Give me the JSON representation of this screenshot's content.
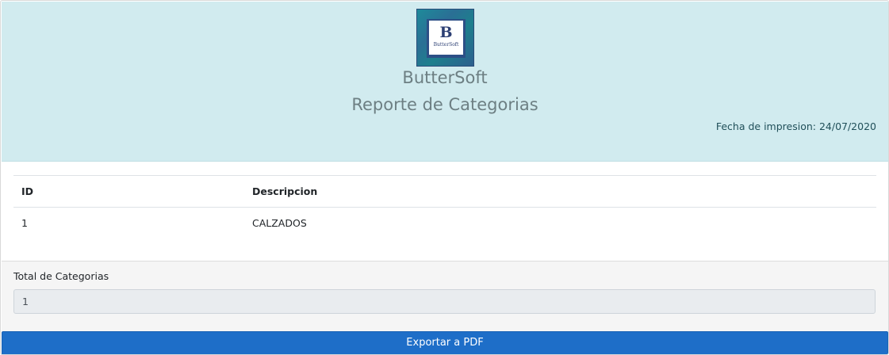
{
  "header": {
    "logo": {
      "letter": "B",
      "wordmark": "ButterSoft"
    },
    "company_name": "ButterSoft",
    "report_title": "Reporte de Categorias",
    "print_date": "Fecha de impresion: 24/07/2020"
  },
  "table": {
    "columns": [
      "ID",
      "Descripcion"
    ],
    "rows": [
      [
        "1",
        "CALZADOS"
      ]
    ]
  },
  "footer": {
    "total_label": "Total de Categorias",
    "total_value": "1"
  },
  "export_button": {
    "label": "Exportar a PDF"
  },
  "colors": {
    "header_bg": "#d1ebef",
    "button_bg": "#1e6ec8",
    "footer_bg": "#f5f5f5"
  }
}
